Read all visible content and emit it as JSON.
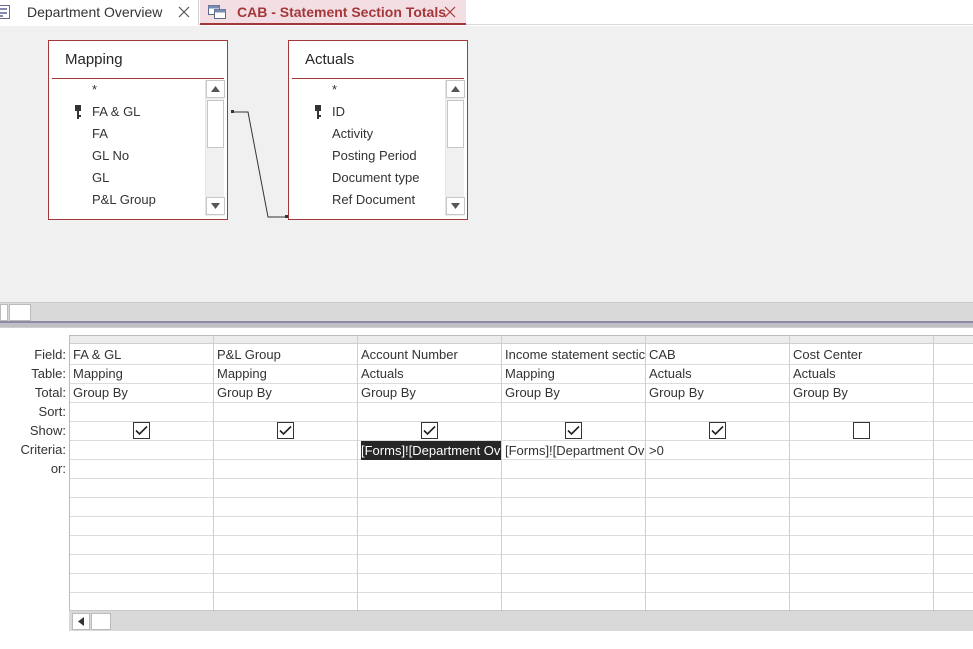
{
  "tabs": [
    {
      "label": "Department Overview",
      "icon": "form-icon"
    },
    {
      "label": "CAB - Statement Section Totals",
      "icon": "query-icon"
    }
  ],
  "tables": [
    {
      "title": "Mapping",
      "fields": [
        "*",
        "FA & GL",
        "FA",
        "GL No",
        "GL",
        "P&L Group"
      ],
      "key_field": "FA & GL"
    },
    {
      "title": "Actuals",
      "fields": [
        "*",
        "ID",
        "Activity",
        "Posting Period",
        "Document type",
        "Ref Document"
      ],
      "key_field": "ID"
    }
  ],
  "row_labels": {
    "field": "Field:",
    "table": "Table:",
    "total": "Total:",
    "sort": "Sort:",
    "show": "Show:",
    "criteria": "Criteria:",
    "or": "or:"
  },
  "columns": [
    {
      "field": "FA & GL",
      "table": "Mapping",
      "total": "Group By",
      "show": true,
      "criteria": ""
    },
    {
      "field": "P&L Group",
      "table": "Mapping",
      "total": "Group By",
      "show": true,
      "criteria": ""
    },
    {
      "field": "Account Number",
      "table": "Actuals",
      "total": "Group By",
      "show": true,
      "criteria": "[Forms]![Department Ov"
    },
    {
      "field": "Income statement sectic",
      "table": "Mapping",
      "total": "Group By",
      "show": true,
      "criteria": "[Forms]![Department Ov"
    },
    {
      "field": "CAB",
      "table": "Actuals",
      "total": "Group By",
      "show": true,
      "criteria": ">0"
    },
    {
      "field": "Cost Center",
      "table": "Actuals",
      "total": "Group By",
      "show": false,
      "criteria": ""
    }
  ],
  "colors": {
    "accent": "#a4373a",
    "active_tab_bg": "#f3dfe3",
    "pane_bg": "#f0f0f0",
    "selected_cell": "#262626"
  }
}
